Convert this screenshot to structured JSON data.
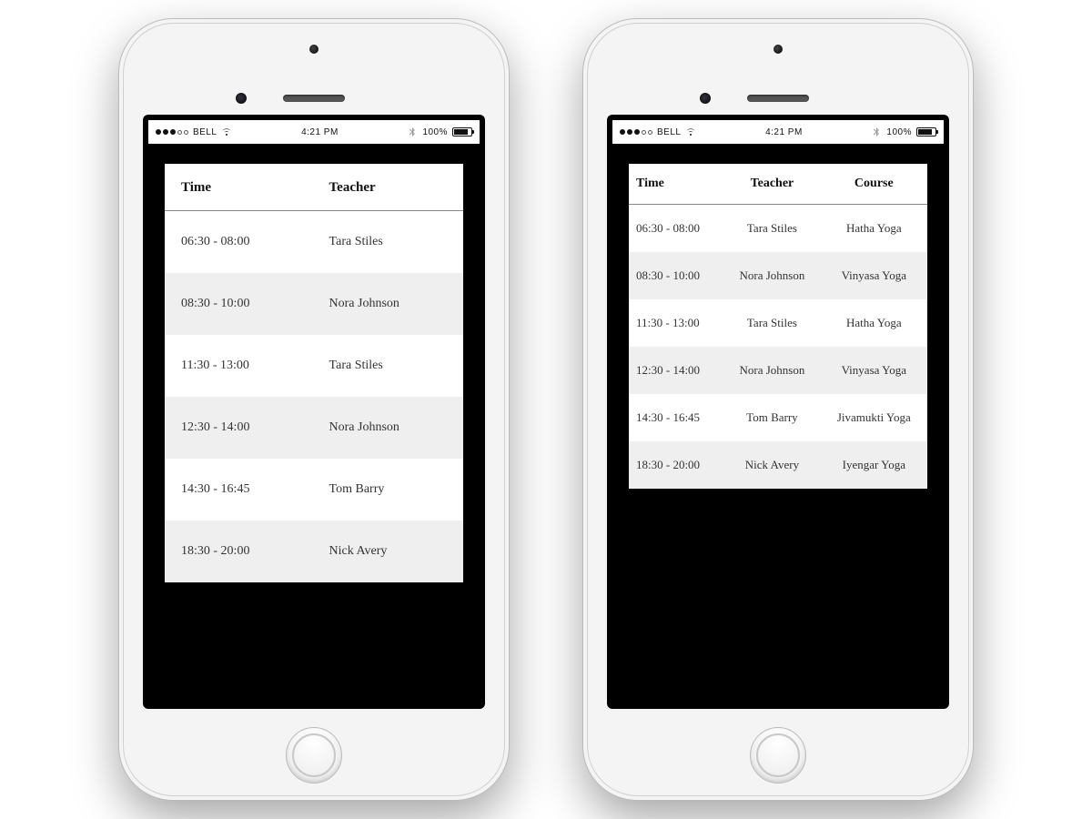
{
  "status": {
    "carrier": "BELL",
    "time": "4:21 PM",
    "battery_pct": "100%"
  },
  "phone1": {
    "headers": {
      "time": "Time",
      "teacher": "Teacher"
    },
    "rows": [
      {
        "time": "06:30 - 08:00",
        "teacher": "Tara Stiles"
      },
      {
        "time": "08:30 - 10:00",
        "teacher": "Nora Johnson"
      },
      {
        "time": "11:30 - 13:00",
        "teacher": "Tara Stiles"
      },
      {
        "time": "12:30 - 14:00",
        "teacher": "Nora Johnson"
      },
      {
        "time": "14:30 - 16:45",
        "teacher": "Tom Barry"
      },
      {
        "time": "18:30 - 20:00",
        "teacher": "Nick Avery"
      }
    ]
  },
  "phone2": {
    "headers": {
      "time": "Time",
      "teacher": "Teacher",
      "course": "Course"
    },
    "rows": [
      {
        "time": "06:30 - 08:00",
        "teacher": "Tara Stiles",
        "course": "Hatha Yoga"
      },
      {
        "time": "08:30 - 10:00",
        "teacher": "Nora Johnson",
        "course": "Vinyasa Yoga"
      },
      {
        "time": "11:30 - 13:00",
        "teacher": "Tara Stiles",
        "course": "Hatha Yoga"
      },
      {
        "time": "12:30 - 14:00",
        "teacher": "Nora Johnson",
        "course": "Vinyasa Yoga"
      },
      {
        "time": "14:30 - 16:45",
        "teacher": "Tom Barry",
        "course": "Jivamukti Yoga"
      },
      {
        "time": "18:30 - 20:00",
        "teacher": "Nick Avery",
        "course": "Iyengar Yoga"
      }
    ]
  }
}
